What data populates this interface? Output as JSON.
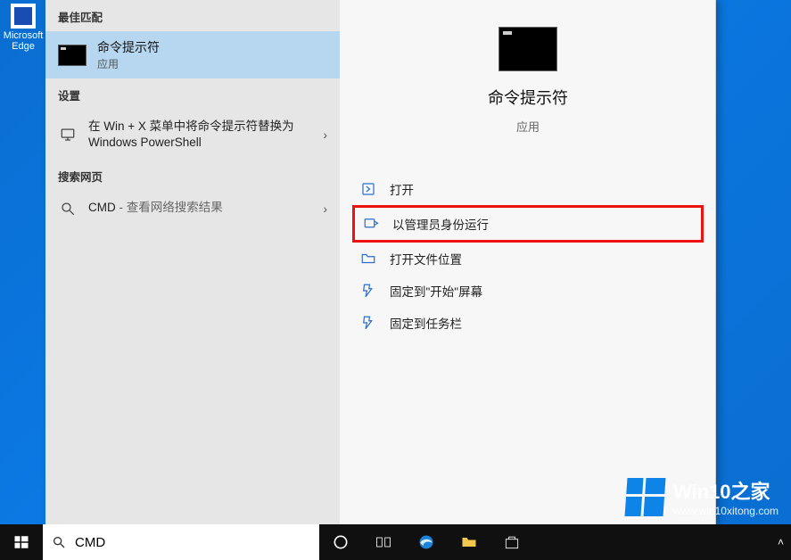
{
  "desktop": {
    "edge_label": "Microsoft Edge"
  },
  "search": {
    "input_value": "CMD"
  },
  "sections": {
    "best_match": "最佳匹配",
    "settings": "设置",
    "web": "搜索网页"
  },
  "best_match_item": {
    "title": "命令提示符",
    "subtitle": "应用"
  },
  "settings_item": {
    "label": "在 Win + X 菜单中将命令提示符替换为 Windows PowerShell"
  },
  "web_item": {
    "prefix": "CMD",
    "suffix": " - 查看网络搜索结果"
  },
  "detail": {
    "title": "命令提示符",
    "subtitle": "应用"
  },
  "actions": {
    "open": "打开",
    "run_admin": "以管理员身份运行",
    "open_location": "打开文件位置",
    "pin_start": "固定到\"开始\"屏幕",
    "pin_taskbar": "固定到任务栏"
  },
  "watermark": {
    "title": "Win10之家",
    "url": "www.win10xitong.com"
  }
}
